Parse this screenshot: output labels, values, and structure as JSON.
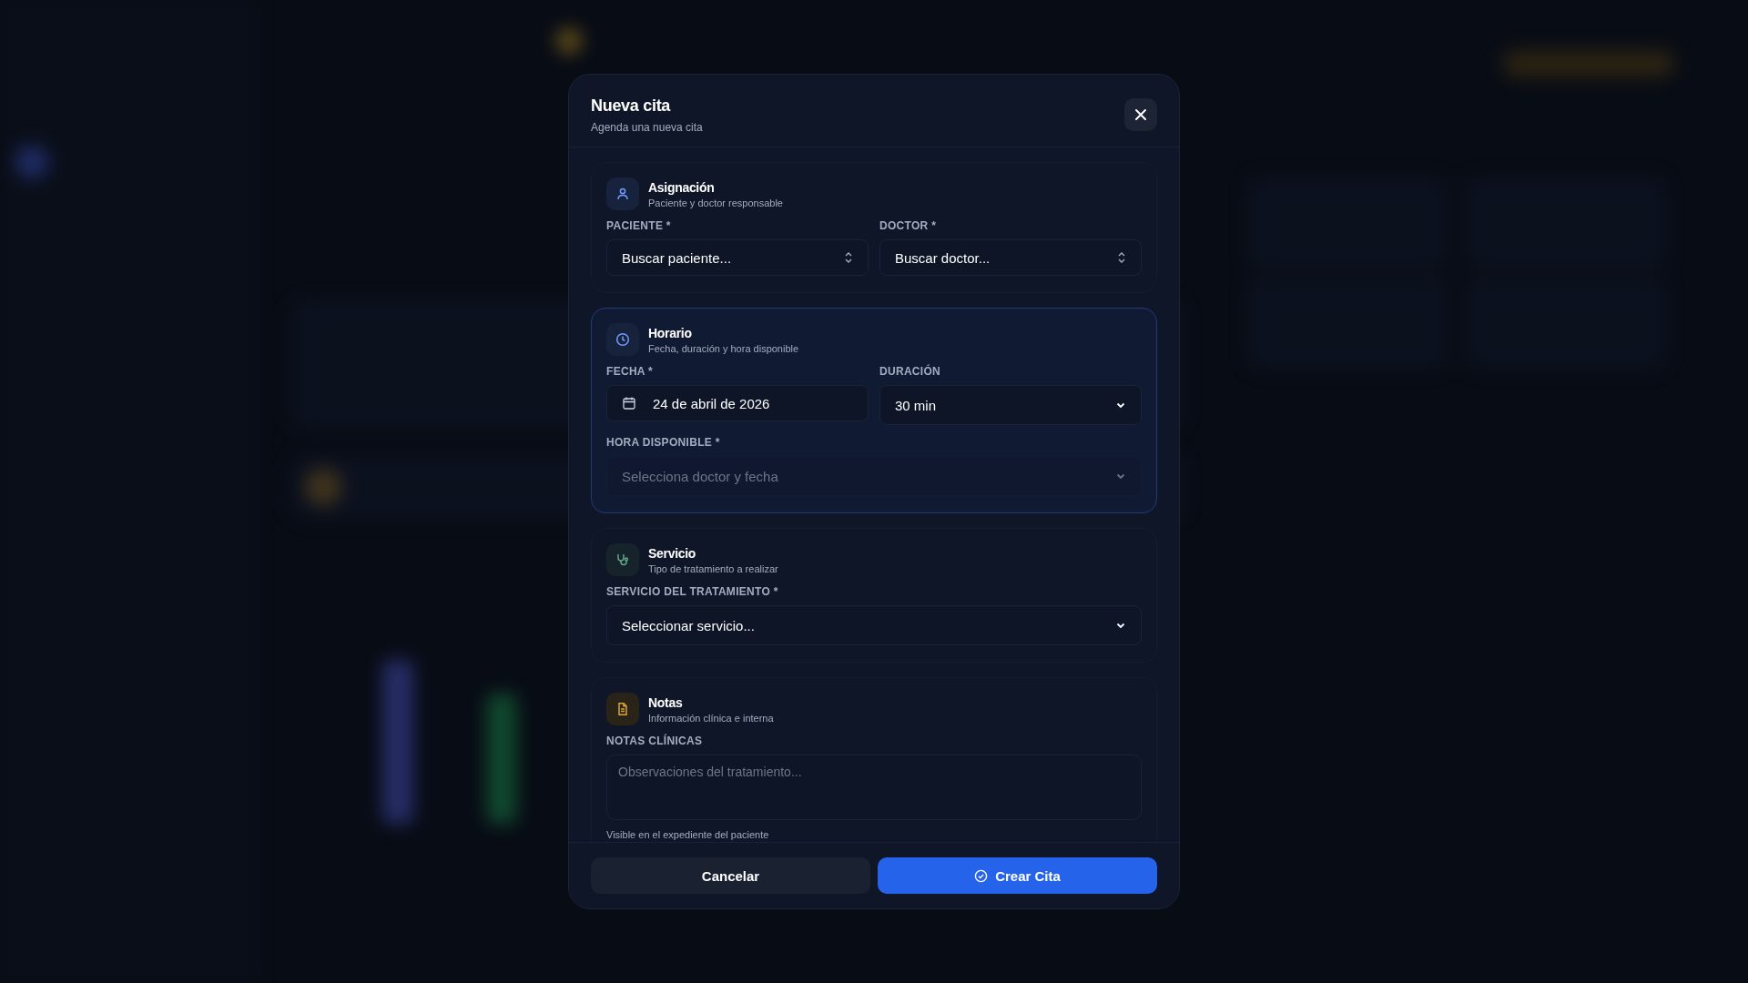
{
  "dialog": {
    "title": "Nueva cita",
    "subtitle": "Agenda una nueva cita"
  },
  "sections": [
    {
      "kind": "assignment",
      "title": "Asignación",
      "subtitle": "Paciente y doctor responsable",
      "highlighted": false,
      "rows": [
        [
          {
            "kind": "combobox",
            "label": "PACIENTE *",
            "value": "Buscar paciente..."
          },
          {
            "kind": "combobox",
            "label": "DOCTOR *",
            "value": "Buscar doctor..."
          }
        ]
      ]
    },
    {
      "kind": "schedule",
      "title": "Horario",
      "subtitle": "Fecha, duración y hora disponible",
      "highlighted": true,
      "rows": [
        [
          {
            "kind": "date",
            "label": "FECHA *",
            "value": "24 de abril de 2026"
          },
          {
            "kind": "select",
            "label": "DURACIÓN",
            "value": "30 min",
            "disabled": false
          }
        ],
        [
          {
            "kind": "select",
            "label": "HORA DISPONIBLE *",
            "placeholder": "Selecciona doctor y fecha",
            "disabled": true
          }
        ]
      ]
    },
    {
      "kind": "service",
      "title": "Servicio",
      "subtitle": "Tipo de tratamiento a realizar",
      "highlighted": false,
      "rows": [
        [
          {
            "kind": "select",
            "label": "SERVICIO DEL TRATAMIENTO *",
            "value": "Seleccionar servicio...",
            "disabled": false
          }
        ]
      ]
    },
    {
      "kind": "notes",
      "title": "Notas",
      "subtitle": "Información clínica e interna",
      "highlighted": false,
      "rows": [
        [
          {
            "kind": "textarea",
            "label": "NOTAS CLÍNICAS",
            "placeholder": "Observaciones del tratamiento...",
            "hint": "Visible en el expediente del paciente"
          }
        ]
      ]
    }
  ],
  "buttons": [
    {
      "kind": "secondary",
      "label": "Cancelar"
    },
    {
      "kind": "primary",
      "label": "Crear Cita"
    }
  ]
}
